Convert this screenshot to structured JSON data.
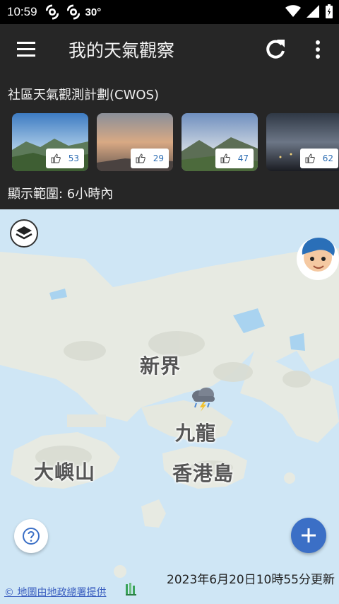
{
  "status_bar": {
    "time": "10:59",
    "temperature": "30°"
  },
  "app_bar": {
    "title": "我的天氣觀察",
    "menu_icon": "hamburger-menu-icon",
    "refresh_icon": "refresh-icon",
    "more_icon": "more-vert-icon"
  },
  "cwos": {
    "heading": "社區天氣觀測計劃(CWOS)",
    "range_label": "顯示範圍: 6小時內",
    "cards": [
      {
        "likes": "53",
        "scene": "blue sky over green hills"
      },
      {
        "likes": "29",
        "scene": "hazy orange sunset sky"
      },
      {
        "likes": "47",
        "scene": "cloudy blue sky over mountains"
      },
      {
        "likes": "62",
        "scene": "dark storm clouds at night over city lights"
      }
    ]
  },
  "map": {
    "places": {
      "new_territories": "新界",
      "kowloon": "九龍",
      "hk_island": "香港島",
      "lantau": "大嶼山"
    },
    "weather_icon": "thunderstorm-icon",
    "update_time": "2023年6月20日10時55分更新",
    "attribution": "© 地圖由地政總署提供"
  },
  "colors": {
    "appbar_bg": "#262626",
    "fab_blue": "#3b6fc6",
    "sea": "#cfe6f5",
    "land": "#e9ece5",
    "link": "#3b5fc0"
  }
}
